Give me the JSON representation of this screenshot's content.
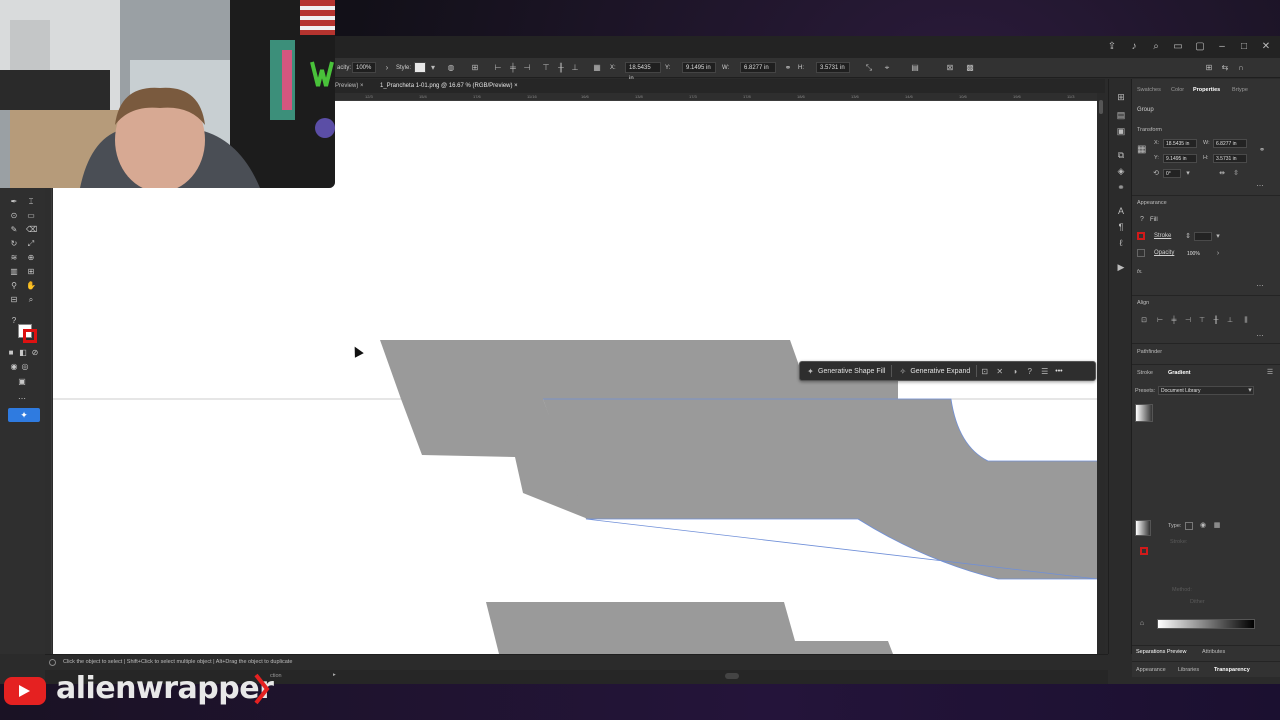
{
  "titlebar": {
    "icons": [
      "share-icon",
      "bell-icon",
      "search-icon",
      "workspace-icon",
      "arrange-icon",
      "minimize-icon",
      "maximize-icon",
      "close-icon"
    ]
  },
  "control_bar": {
    "opacity_label": "acity:",
    "opacity_value": "100%",
    "style_label": "Style:",
    "x_label": "X:",
    "x_value": "18.5435 in",
    "y_label": "Y:",
    "y_value": "9.1495 in",
    "w_label": "W:",
    "w_value": "6.8277 in",
    "h_label": "H:",
    "h_value": "3.5731 in"
  },
  "doc_tabs": [
    {
      "label": "Preview)",
      "close": "×",
      "active": false
    },
    {
      "label": "1_Prancheta 1-01.png @ 16.67 % (RGB/Preview)",
      "close": "×",
      "active": true
    }
  ],
  "ruler_ticks": [
    "12/3",
    "15/4",
    "17/6",
    "11/16",
    "16/6",
    "13/8",
    "17/3",
    "17/8",
    "18/6",
    "13/6",
    "14/6",
    "10/6",
    "19/6",
    "11/3"
  ],
  "context_bar": {
    "generative_shape_fill": "Generative Shape Fill",
    "generative_expand": "Generative Expand",
    "more": "•••"
  },
  "properties_panel": {
    "tabs": [
      "Swatches",
      "Color",
      "Properties",
      "Brtype"
    ],
    "active_tab": "Properties",
    "object_type": "Group",
    "transform_heading": "Transform",
    "x_label": "X:",
    "x_value": "18.5435 in",
    "y_label": "Y:",
    "y_value": "9.1495 in",
    "w_label": "W:",
    "w_value": "6.8277 in",
    "h_label": "H:",
    "h_value": "3.5731 in",
    "rotate_value": "0°",
    "appearance_heading": "Appearance",
    "fill_label": "Fill",
    "stroke_label": "Stroke",
    "opacity_label": "Opacity",
    "opacity_value": "100%",
    "fx_label": "fx.",
    "align_heading": "Align",
    "pathfinder_heading": "Pathfinder",
    "subtabs": [
      "Stroke",
      "Gradient"
    ],
    "active_subtab": "Gradient",
    "presets_label": "Presets:",
    "presets_value": "Document Library",
    "type_label": "Type:",
    "stroke_faded": "Stroke:",
    "method_faded": "Method:",
    "dither_faded": "Dither",
    "bottom_tabs_1": [
      "Separations Preview",
      "Attributes"
    ],
    "bottom_tabs_2": [
      "Appearance",
      "Libraries",
      "Transparency"
    ],
    "colors": {
      "stroke_swatch": "#d11a1a",
      "gradient_start": "#ffffff",
      "gradient_end": "#000000"
    }
  },
  "status": {
    "hint": "Click the object to select  |  Shift+Click to select multiple object  |  Alt+Drag the object to duplicate",
    "selection_label": "ction"
  },
  "canvas": {
    "shape_fill": "#9a9a9a",
    "selection_color": "#6f8fd8",
    "guide_color": "#cccccc"
  },
  "overlay": {
    "channel_name": "alienwrapper",
    "brand_color": "#e52121",
    "accent_color": "#e52121"
  }
}
